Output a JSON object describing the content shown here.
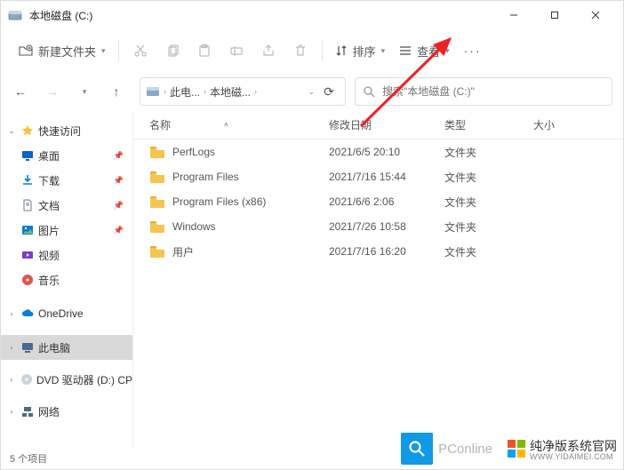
{
  "title": "本地磁盘 (C:)",
  "toolbar": {
    "new_folder": "新建文件夹",
    "sort": "排序",
    "view": "查看"
  },
  "breadcrumb": {
    "items": [
      "此电...",
      "本地磁..."
    ]
  },
  "search": {
    "placeholder": "搜索\"本地磁盘 (C:)\""
  },
  "columns": {
    "name": "名称",
    "date": "修改日期",
    "type": "类型",
    "size": "大小"
  },
  "rows": [
    {
      "name": "PerfLogs",
      "date": "2021/6/5 20:10",
      "type": "文件夹"
    },
    {
      "name": "Program Files",
      "date": "2021/7/16 15:44",
      "type": "文件夹"
    },
    {
      "name": "Program Files (x86)",
      "date": "2021/6/6 2:06",
      "type": "文件夹"
    },
    {
      "name": "Windows",
      "date": "2021/7/26 10:58",
      "type": "文件夹"
    },
    {
      "name": "用户",
      "date": "2021/7/16 16:20",
      "type": "文件夹"
    }
  ],
  "sidebar": {
    "quick": "快速访问",
    "desktop": "桌面",
    "downloads": "下载",
    "documents": "文档",
    "pictures": "图片",
    "videos": "视频",
    "music": "音乐",
    "onedrive": "OneDrive",
    "thispc": "此电脑",
    "dvd": "DVD 驱动器 (D:) CP",
    "network": "网络"
  },
  "status": "5 个项目",
  "watermark1": "PConline",
  "watermark2": "纯净版系统官网",
  "watermark2_sub": "WWW.YIDAIMEI.COM"
}
